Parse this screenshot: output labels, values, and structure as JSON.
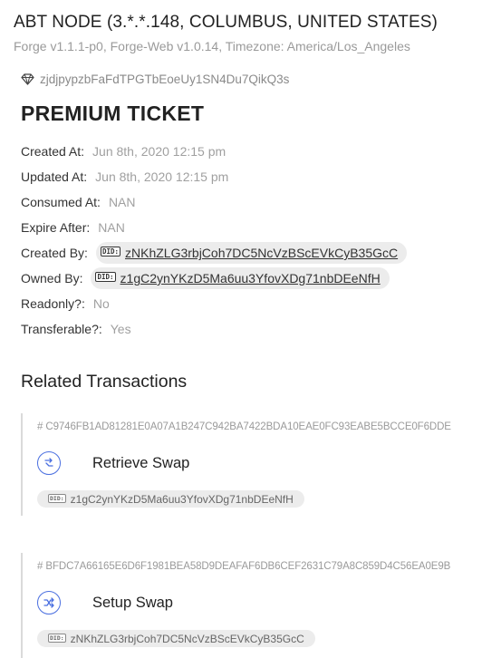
{
  "header": {
    "title": "ABT NODE (3.*.*.148, COLUMBUS, UNITED STATES)",
    "subtitle": "Forge v1.1.1-p0, Forge-Web v1.0.14, Timezone: America/Los_Angeles"
  },
  "asset": {
    "address": "zjdjpypzbFaFdTPGTbEoeUy1SN4Du7QikQ3s",
    "icon": "diamond-icon",
    "title": "PREMIUM TICKET"
  },
  "properties": {
    "created_at": {
      "label": "Created At:",
      "value": "Jun 8th, 2020 12:15 pm"
    },
    "updated_at": {
      "label": "Updated At:",
      "value": "Jun 8th, 2020 12:15 pm"
    },
    "consumed_at": {
      "label": "Consumed At:",
      "value": "NAN"
    },
    "expire_after": {
      "label": "Expire After:",
      "value": "NAN"
    },
    "created_by": {
      "label": "Created By:",
      "did_badge": "DID:",
      "value": "zNKhZLG3rbjCoh7DC5NcVzBScEVkCyB35GcC"
    },
    "owned_by": {
      "label": "Owned By:",
      "did_badge": "DID:",
      "value": "z1gC2ynYKzD5Ma6uu3YfovXDg71nbDEeNfH"
    },
    "readonly": {
      "label": "Readonly?:",
      "value": "No"
    },
    "transferable": {
      "label": "Transferable?:",
      "value": "Yes"
    }
  },
  "related": {
    "title": "Related Transactions",
    "transactions": [
      {
        "hash": "# C9746FB1AD81281E0A07A1B247C942BA7422BDA10EAE0FC93EABE5BCCE0F6DDE",
        "icon": "retrieve-swap-icon",
        "type": "Retrieve Swap",
        "did_badge": "DID:",
        "owner": "z1gC2ynYKzD5Ma6uu3YfovXDg71nbDEeNfH"
      },
      {
        "hash": "# BFDC7A66165E6D6F1981BEA58D9DEAFAF6DB6CEF2631C79A8C859D4C56EA0E9B",
        "icon": "setup-swap-icon",
        "type": "Setup Swap",
        "did_badge": "DID:",
        "owner": "zNKhZLG3rbjCoh7DC5NcVzBScEVkCyB35GcC"
      }
    ]
  },
  "colors": {
    "accent": "#4a6fe0",
    "pill_bg": "#ececec",
    "muted_text": "#a0a0a0"
  }
}
